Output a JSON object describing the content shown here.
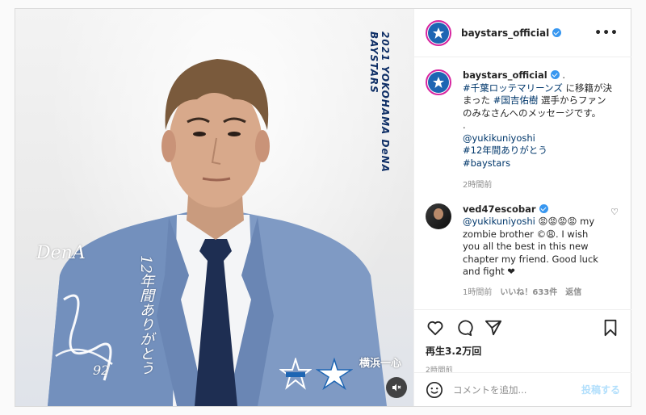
{
  "media": {
    "vertical_title": "2021 YOKOHAMA DeNA BAYSTARS",
    "signature_name": "DenA",
    "signature_message": "12年間ありがとう",
    "signature_number": "92",
    "team_logo_text": "横浜一心"
  },
  "header": {
    "username": "baystars_official",
    "more_label": "•••"
  },
  "caption": {
    "username": "baystars_official",
    "first_line_suffix": " .",
    "text_parts": [
      {
        "type": "tag",
        "text": "#千葉ロッテマリーンズ"
      },
      {
        "type": "text",
        "text": " に移籍が決まった "
      },
      {
        "type": "tag",
        "text": "#国吉佑樹"
      },
      {
        "type": "text",
        "text": " 選手からファンのみなさんへのメッセージです。"
      }
    ],
    "dot_line": ".",
    "mention": "@yukikuniyoshi",
    "tags": [
      "#12年間ありがとう",
      "#baystars"
    ],
    "time": "2時間前"
  },
  "comment": {
    "username": "ved47escobar",
    "mention": "@yukikuniyoshi",
    "emojis": "😡😡😡😡",
    "text": " my zombie brother ©😩. I wish you all the best in this new chapter my friend. Good luck and fight ❤",
    "time": "1時間前",
    "likes": "いいね！633件",
    "reply": "返信"
  },
  "actions": {
    "views": "再生3.2万回",
    "post_time": "2時間前"
  },
  "add_comment": {
    "placeholder": "コメントを追加...",
    "post_label": "投稿する"
  },
  "colors": {
    "link": "#00376b",
    "verified": "#3897f0",
    "brand_blue": "#1d65b3",
    "post_disabled": "#b2dffc"
  }
}
